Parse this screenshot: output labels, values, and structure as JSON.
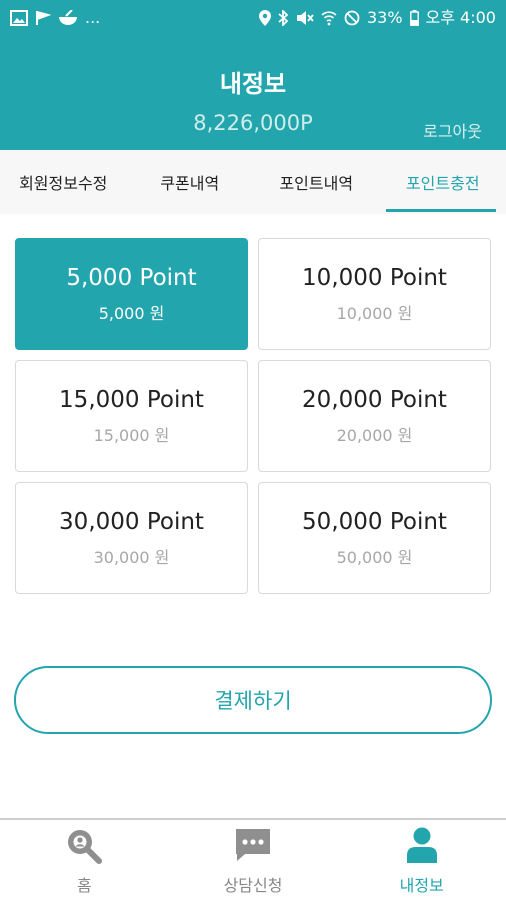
{
  "status_bar": {
    "left_icons": [
      "image-icon",
      "flag-icon",
      "bowl-icon",
      "more-notifications"
    ],
    "more_text": "...",
    "right_icons": [
      "location-icon",
      "bluetooth-icon",
      "mute-icon",
      "wifi-icon",
      "dnd-icon",
      "battery-icon"
    ],
    "battery": "33%",
    "time": "오후 4:00"
  },
  "header": {
    "title": "내정보",
    "points": "8,226,000P",
    "logout": "로그아웃"
  },
  "tabs": [
    {
      "label": "회원정보수정",
      "active": false
    },
    {
      "label": "쿠폰내역",
      "active": false
    },
    {
      "label": "포인트내역",
      "active": false
    },
    {
      "label": "포인트충전",
      "active": true
    }
  ],
  "options": [
    {
      "point": "5,000 Point",
      "price": "5,000 원",
      "selected": true
    },
    {
      "point": "10,000 Point",
      "price": "10,000 원",
      "selected": false
    },
    {
      "point": "15,000 Point",
      "price": "15,000 원",
      "selected": false
    },
    {
      "point": "20,000 Point",
      "price": "20,000 원",
      "selected": false
    },
    {
      "point": "30,000 Point",
      "price": "30,000 원",
      "selected": false
    },
    {
      "point": "50,000 Point",
      "price": "50,000 원",
      "selected": false
    }
  ],
  "pay_button": "결제하기",
  "bottom_nav": [
    {
      "label": "홈",
      "icon": "search-icon",
      "active": false
    },
    {
      "label": "상담신청",
      "icon": "chat-icon",
      "active": false
    },
    {
      "label": "내정보",
      "icon": "person-icon",
      "active": true
    }
  ],
  "colors": {
    "accent": "#23a5ae",
    "inactive_icon": "#8f8f8f"
  }
}
